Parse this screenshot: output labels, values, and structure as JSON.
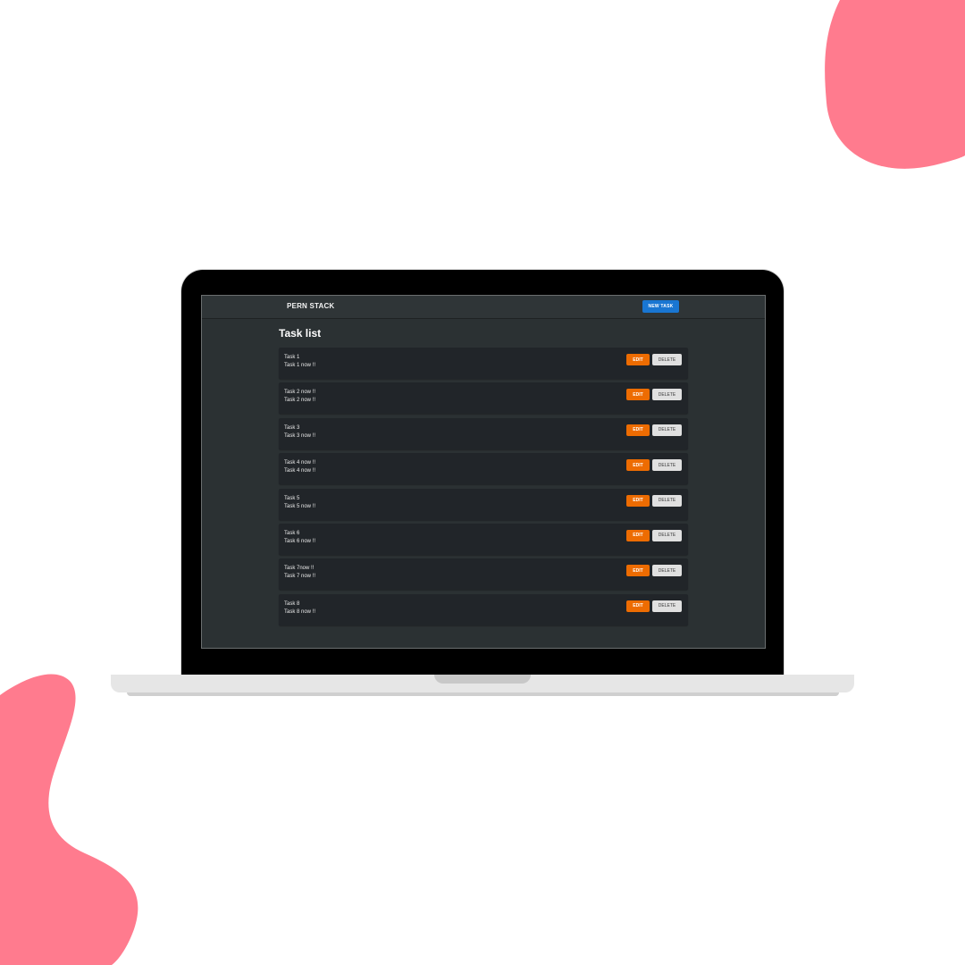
{
  "colors": {
    "blob": "#ff7b8e",
    "navbar": "#2f3537",
    "screen_bg": "#2b3133",
    "card_bg": "#212529",
    "new_task_button": "#1976d2",
    "edit_button": "#ed6c02",
    "delete_button": "#e0e0e0"
  },
  "app": {
    "brand": "PERN STACK",
    "new_task_label": "NEW TASK",
    "page_title": "Task list"
  },
  "tasks": [
    {
      "title": "Task 1",
      "description": "Task 1 now !!",
      "edit_label": "EDIT",
      "delete_label": "DELETE"
    },
    {
      "title": "Task 2 now !!",
      "description": "Task 2 now !!",
      "edit_label": "EDIT",
      "delete_label": "DELETE"
    },
    {
      "title": "Task 3",
      "description": "Task 3 now !!",
      "edit_label": "EDIT",
      "delete_label": "DELETE"
    },
    {
      "title": "Task 4 now !!",
      "description": "Task 4 now !!",
      "edit_label": "EDIT",
      "delete_label": "DELETE"
    },
    {
      "title": "Task 5",
      "description": "Task 5 now !!",
      "edit_label": "EDIT",
      "delete_label": "DELETE"
    },
    {
      "title": "Task 6",
      "description": "Task 6 now !!",
      "edit_label": "EDIT",
      "delete_label": "DELETE"
    },
    {
      "title": "Task 7now !!",
      "description": "Task 7 now !!",
      "edit_label": "EDIT",
      "delete_label": "DELETE"
    },
    {
      "title": "Task 8",
      "description": "Task 8 now !!",
      "edit_label": "EDIT",
      "delete_label": "DELETE"
    }
  ]
}
